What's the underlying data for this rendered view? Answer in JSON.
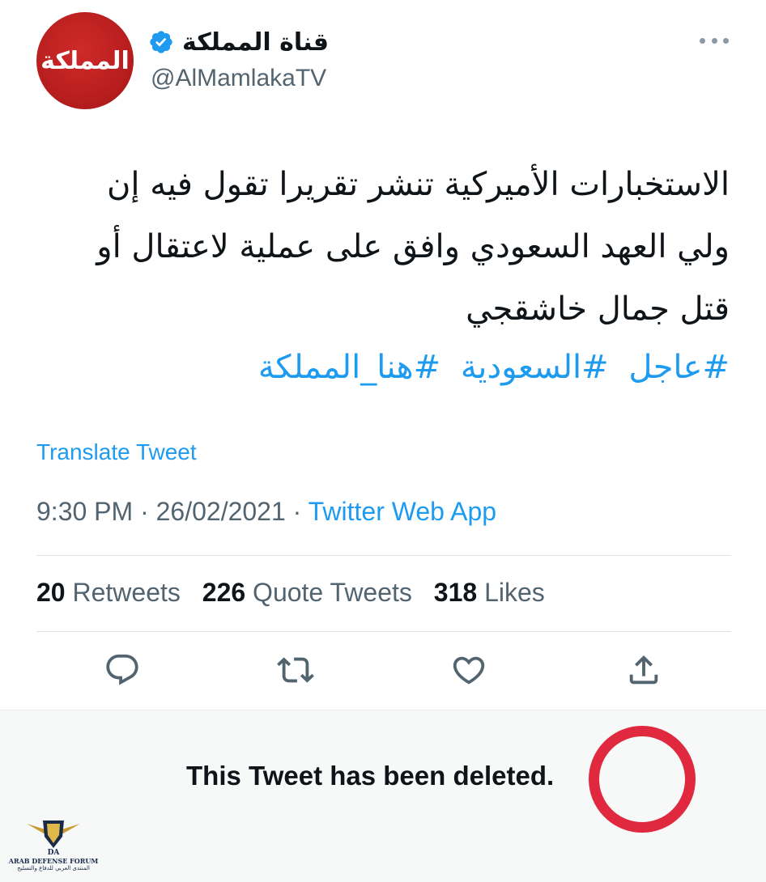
{
  "tweet": {
    "author": {
      "display_name": "قناة المملكة",
      "handle": "@AlMamlakaTV",
      "avatar_text": "المملكة",
      "verified": true
    },
    "body_lines": [
      "الاستخبارات الأميركية تنشر تقريرا تقول فيه إن",
      "ولي العهد السعودي وافق على عملية لاعتقال أو",
      "قتل جمال خاشقجي"
    ],
    "hashtags": [
      "#عاجل",
      "#السعودية",
      "#هنا_المملكة"
    ],
    "translate_label": "Translate Tweet",
    "time": "9:30 PM",
    "date": "26/02/2021",
    "separator": " · ",
    "source": "Twitter Web App",
    "stats": {
      "retweets_count": "20",
      "retweets_label": "Retweets",
      "quotes_count": "226",
      "quotes_label": "Quote Tweets",
      "likes_count": "318",
      "likes_label": "Likes"
    },
    "icons": [
      "reply-icon",
      "retweet-icon",
      "like-icon",
      "share-icon",
      "more-icon",
      "verified-icon"
    ]
  },
  "deleted_notice": {
    "text": "This Tweet has been deleted."
  },
  "watermark": {
    "title_en": "ARAB DEFENSE FORUM",
    "title_ar": "المنتدى العربي للدفاع والتسليح"
  },
  "colors": {
    "accent": "#1d9bf0",
    "secondary_text": "#536471",
    "annotation_red": "#e0283e",
    "avatar_red": "#b71d1d"
  }
}
